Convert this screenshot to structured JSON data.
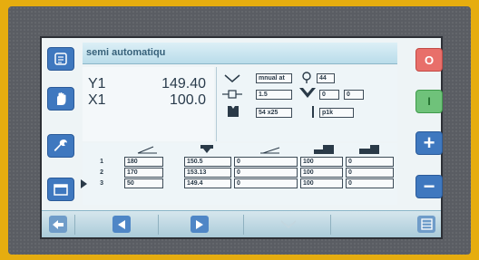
{
  "header": {
    "title": "semi automatiqu"
  },
  "axes": [
    {
      "label": "Y1",
      "value": "149.40"
    },
    {
      "label": "X1",
      "value": "100.0"
    }
  ],
  "params": {
    "mode": "mnual at",
    "tool": "44",
    "die_width": "1.5",
    "bend_a": "0",
    "bend_b": "0",
    "punch": "54 x25",
    "prog": "p1k"
  },
  "table": {
    "rows": [
      {
        "num": "1",
        "cells": [
          "180",
          "150.5",
          "0",
          "100",
          "0"
        ]
      },
      {
        "num": "2",
        "cells": [
          "170",
          "153.13",
          "0",
          "100",
          "0"
        ]
      },
      {
        "num": "3",
        "cells": [
          "50",
          "149.4",
          "0",
          "100",
          "0"
        ]
      }
    ],
    "active_row_index": 2
  },
  "side_buttons": {
    "stop": "O",
    "start": "I",
    "plus": "+",
    "minus": "−"
  },
  "colors": {
    "bezel": "#e6ad0f",
    "accent_blue": "#3f78bf",
    "stop_red": "#e86f6a",
    "start_green": "#6fc27a"
  },
  "icons": [
    "menu-icon",
    "hand-icon",
    "wrench-icon",
    "calendar-icon",
    "back-arrow-icon",
    "play-left-icon",
    "play-right-icon",
    "chevron-down-icon",
    "grid-icon"
  ]
}
